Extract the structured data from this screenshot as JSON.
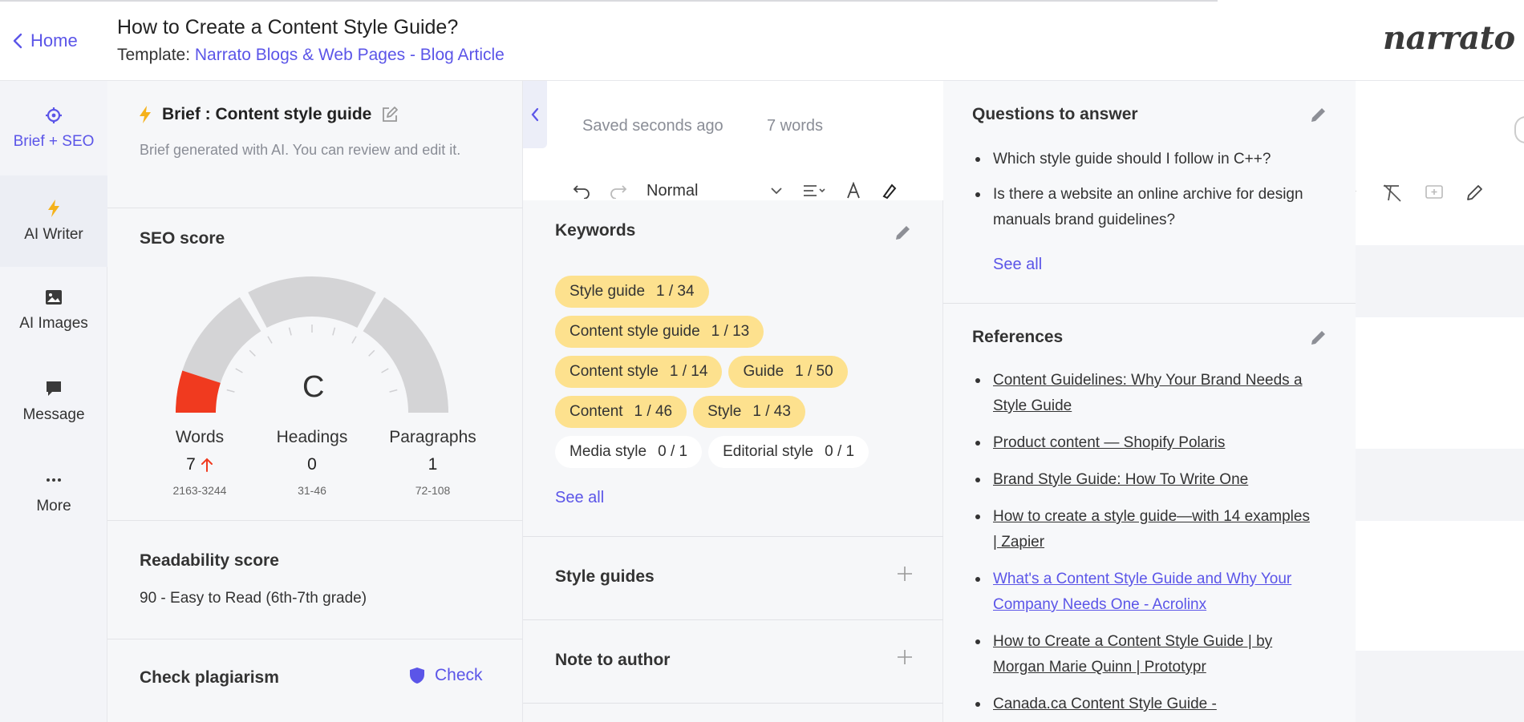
{
  "header": {
    "back_label": "Home",
    "title": "How to Create a Content Style Guide?",
    "template_prefix": "Template: ",
    "template_name": "Narrato Blogs & Web Pages - Blog Article",
    "logo": "narrato"
  },
  "nav": {
    "items": [
      {
        "label": "Brief + SEO",
        "icon": "target-icon"
      },
      {
        "label": "AI Writer",
        "icon": "lightning-icon"
      },
      {
        "label": "AI Images",
        "icon": "image-icon"
      },
      {
        "label": "Message",
        "icon": "chat-icon"
      },
      {
        "label": "More",
        "icon": "more-dots-icon"
      }
    ]
  },
  "brief": {
    "title": "Brief : Content style guide",
    "description": "Brief generated with AI. You can review and edit it.",
    "seo": {
      "label": "SEO score",
      "grade": "C",
      "score_fraction": 0.1,
      "stats": [
        {
          "label": "Words",
          "value": "7",
          "range": "2163-3244",
          "trend": "up"
        },
        {
          "label": "Headings",
          "value": "0",
          "range": "31-46"
        },
        {
          "label": "Paragraphs",
          "value": "1",
          "range": "72-108"
        }
      ]
    },
    "readability": {
      "label": "Readability score",
      "value": "90 - Easy to Read (6th-7th grade)"
    },
    "plagiarism": {
      "label": "Check plagiarism",
      "button": "Check"
    }
  },
  "editor": {
    "saved_status": "Saved seconds ago",
    "word_count": "7 words",
    "format_select": "Normal"
  },
  "keywords": {
    "title": "Keywords",
    "items": [
      {
        "term": "Style guide",
        "count": "1 / 34",
        "used": true
      },
      {
        "term": "Content style guide",
        "count": "1 / 13",
        "used": true
      },
      {
        "term": "Content style",
        "count": "1 / 14",
        "used": true
      },
      {
        "term": "Guide",
        "count": "1 / 50",
        "used": true
      },
      {
        "term": "Content",
        "count": "1 / 46",
        "used": true
      },
      {
        "term": "Style",
        "count": "1 / 43",
        "used": true
      },
      {
        "term": "Media style",
        "count": "0 / 1",
        "used": false
      },
      {
        "term": "Editorial style",
        "count": "0 / 1",
        "used": false
      }
    ],
    "see_all": "See all"
  },
  "style_guides": {
    "title": "Style guides"
  },
  "note_to_author": {
    "title": "Note to author"
  },
  "questions": {
    "title": "Questions to answer",
    "items": [
      "Which style guide should I follow in C++?",
      "Is there a website an online archive for design manuals brand guidelines?"
    ],
    "see_all": "See all"
  },
  "references": {
    "title": "References",
    "items": [
      {
        "text": "Content Guidelines: Why Your Brand Needs a Style Guide",
        "visited": false
      },
      {
        "text": "Product content — Shopify Polaris",
        "visited": false
      },
      {
        "text": "Brand Style Guide: How To Write One",
        "visited": false
      },
      {
        "text": "How to create a style guide—with 14 examples | Zapier",
        "visited": false
      },
      {
        "text": "What's a Content Style Guide and Why Your Company Needs One - Acrolinx",
        "visited": true
      },
      {
        "text": "How to Create a Content Style Guide | by Morgan Marie Quinn | Prototypr",
        "visited": false
      },
      {
        "text": "Canada.ca Content Style Guide -",
        "visited": false
      }
    ]
  },
  "colors": {
    "accent": "#5b55e8",
    "chip_used": "#fde18e",
    "gauge_fill": "#f03a1f",
    "gauge_track": "#d4d4d6"
  }
}
